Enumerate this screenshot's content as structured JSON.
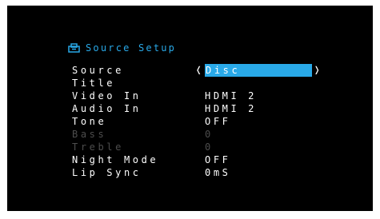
{
  "menu": {
    "title": "Source Setup",
    "title_icon": "setup-icon",
    "accent_color": "#29a9e8",
    "rows": [
      {
        "label": "Source",
        "value": "Disc",
        "state": "selected"
      },
      {
        "label": "Title",
        "value": "",
        "state": "enabled"
      },
      {
        "label": "Video In",
        "value": "HDMI 2",
        "state": "enabled"
      },
      {
        "label": "Audio In",
        "value": "HDMI 2",
        "state": "enabled"
      },
      {
        "label": "Tone",
        "value": "OFF",
        "state": "enabled"
      },
      {
        "label": "Bass",
        "value": "0",
        "state": "disabled"
      },
      {
        "label": "Treble",
        "value": "0",
        "state": "disabled"
      },
      {
        "label": "Night Mode",
        "value": "OFF",
        "state": "enabled"
      },
      {
        "label": "Lip Sync",
        "value": "0mS",
        "state": "enabled"
      }
    ],
    "arrow_left": "❬",
    "arrow_right": "❭"
  }
}
